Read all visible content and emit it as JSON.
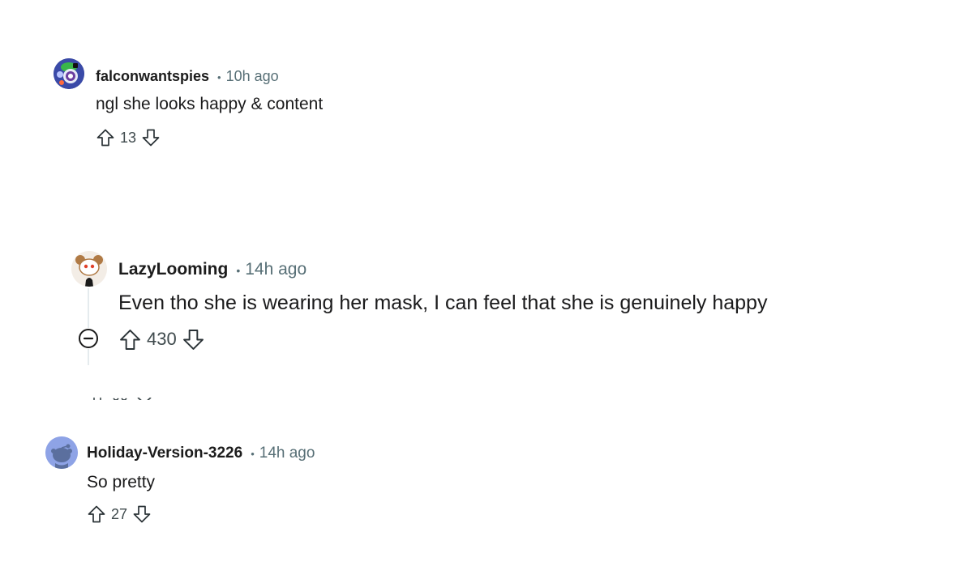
{
  "comments": [
    {
      "author": "falconwantspies",
      "separator": "•",
      "time": "10h ago",
      "body": "ngl she looks happy & content",
      "score": "13",
      "avatar_icon": "falcon-avatar-icon"
    },
    {
      "author": "LazyLooming",
      "separator": "•",
      "time": "14h ago",
      "body": "Even tho she is wearing her mask, I can feel that she is genuinely happy",
      "score": "430",
      "avatar_icon": "bear-snoo-avatar-icon"
    },
    {
      "author": "Holiday-Version-3226",
      "separator": "•",
      "time": "14h ago",
      "body": "So pretty",
      "score": "27",
      "avatar_icon": "default-snoo-avatar-icon"
    }
  ],
  "colors": {
    "meta_gray": "#576f76",
    "text": "#1a1a1b",
    "thread_line": "#e5ebee",
    "default_avatar_bg": "#8ea3e6"
  }
}
